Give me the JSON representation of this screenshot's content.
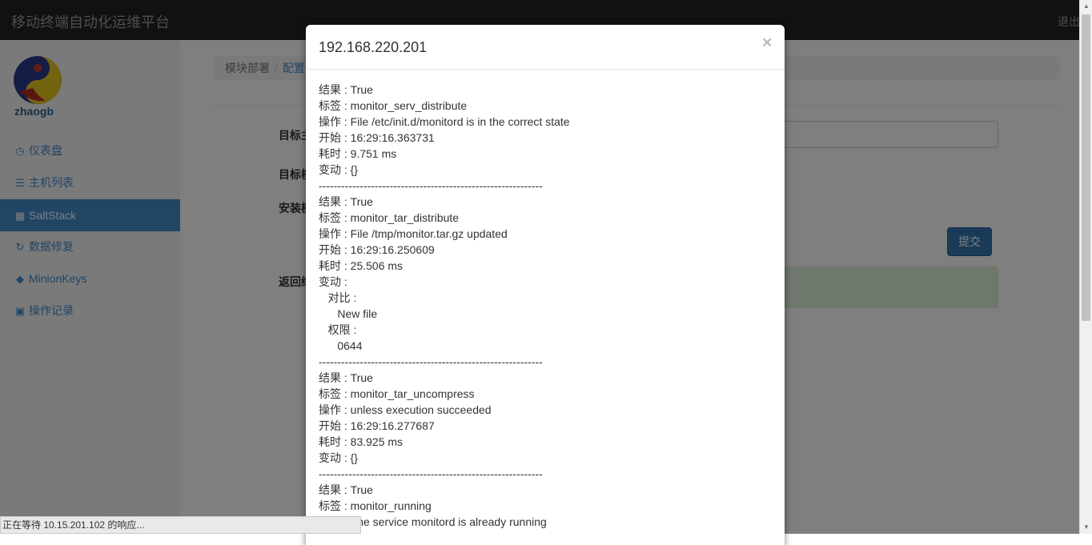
{
  "navbar": {
    "brand": "移动终端自动化运维平台",
    "logout": "退出"
  },
  "sidebar": {
    "username": "zhaogb",
    "items": [
      {
        "icon": "dashboard-icon",
        "glyph": "◷",
        "label": "仪表盘"
      },
      {
        "icon": "list-icon",
        "glyph": "☰",
        "label": "主机列表"
      },
      {
        "icon": "grid-icon",
        "glyph": "▦",
        "label": "SaltStack",
        "active": true
      },
      {
        "icon": "refresh-icon",
        "glyph": "↻",
        "label": "数据修复"
      },
      {
        "icon": "tags-icon",
        "glyph": "◆",
        "label": "MinionKeys"
      },
      {
        "icon": "save-icon",
        "glyph": "▣",
        "label": "操作记录"
      }
    ]
  },
  "main": {
    "breadcrumb": {
      "item1": "模块部署",
      "separator": "/",
      "item2": "配置"
    },
    "labels": [
      "目标主",
      "目标模",
      "安装模",
      "返回结"
    ],
    "submit_label": "提交"
  },
  "modal": {
    "title": "192.168.220.201",
    "close": "×",
    "lines": [
      "结果 : True",
      "标签 : monitor_serv_distribute",
      "操作 : File /etc/init.d/monitord is in the correct state",
      "开始 : 16:29:16.363731",
      "耗时 : 9.751 ms",
      "变动 : {}",
      "------------------------------------------------------------",
      "结果 : True",
      "标签 : monitor_tar_distribute",
      "操作 : File /tmp/monitor.tar.gz updated",
      "开始 : 16:29:16.250609",
      "耗时 : 25.506 ms",
      "变动 :",
      "   对比 :",
      "      New file",
      "   权限 :",
      "      0644",
      "------------------------------------------------------------",
      "结果 : True",
      "标签 : monitor_tar_uncompress",
      "操作 : unless execution succeeded",
      "开始 : 16:29:16.277687",
      "耗时 : 83.925 ms",
      "变动 : {}",
      "------------------------------------------------------------",
      "结果 : True",
      "标签 : monitor_running",
      "操作 : The service monitord is already running"
    ]
  },
  "statusbar": {
    "text": "正在等待 10.15.201.102 的响应..."
  },
  "colors": {
    "navbar": "#222222",
    "accent": "#428bca",
    "success_bg": "#dff0d8"
  }
}
